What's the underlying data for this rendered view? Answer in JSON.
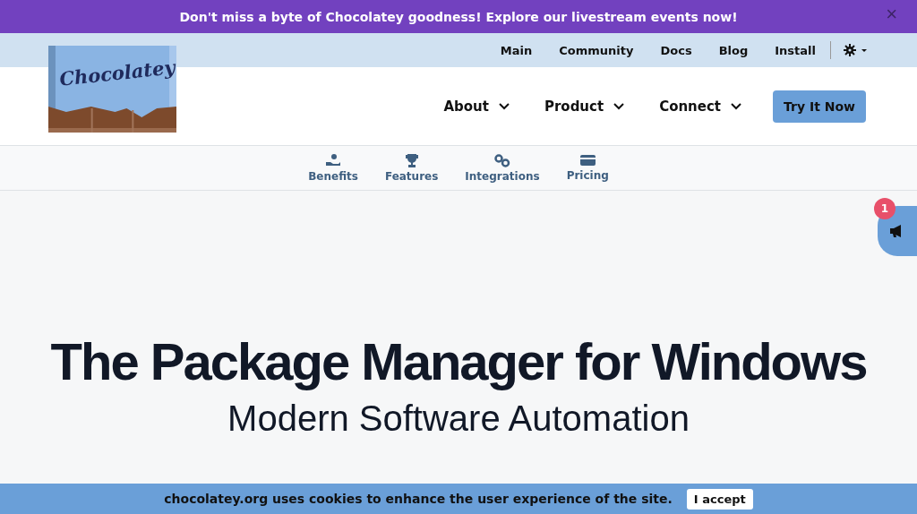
{
  "announcement": {
    "text": "Don't miss a byte of Chocolatey goodness! Explore our livestream events now!",
    "close": "×"
  },
  "top_links": [
    "Main",
    "Community",
    "Docs",
    "Blog",
    "Install"
  ],
  "logo": {
    "text": "Chocolatey"
  },
  "main_nav": [
    {
      "label": "About",
      "kind": "dropdown"
    },
    {
      "label": "Product",
      "kind": "dropdown"
    },
    {
      "label": "Connect",
      "kind": "dropdown"
    },
    {
      "label": "Try It Now",
      "kind": "button"
    }
  ],
  "sub_nav": [
    {
      "label": "Benefits",
      "kind": "benefits"
    },
    {
      "label": "Features",
      "kind": "features"
    },
    {
      "label": "Integrations",
      "kind": "integrations"
    },
    {
      "label": "Pricing",
      "kind": "pricing"
    }
  ],
  "notifications": {
    "count": "1"
  },
  "hero": {
    "title": "The Package Manager for Windows",
    "subtitle": "Modern Software Automation"
  },
  "cookie_bar": {
    "text": "chocolatey.org uses cookies to enhance the user experience of the site.",
    "button": "I accept"
  }
}
